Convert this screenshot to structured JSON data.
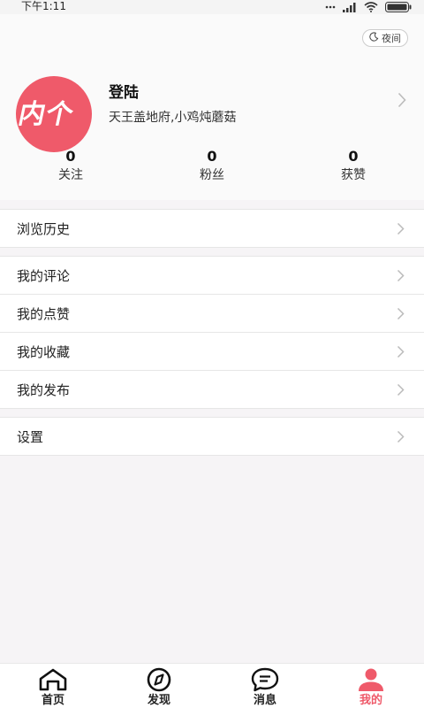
{
  "status_bar": {
    "time": "下午1:11"
  },
  "header": {
    "night_mode_label": "夜间",
    "avatar_text": "内个",
    "username": "登陆",
    "bio": "天王盖地府,小鸡炖蘑菇"
  },
  "stats": [
    {
      "value": "0",
      "label": "关注"
    },
    {
      "value": "0",
      "label": "粉丝"
    },
    {
      "value": "0",
      "label": "获赞"
    }
  ],
  "menu": {
    "history": "浏览历史",
    "comments": "我的评论",
    "likes": "我的点赞",
    "favorites": "我的收藏",
    "posts": "我的发布",
    "settings": "设置"
  },
  "tabs": [
    {
      "label": "首页",
      "icon": "home-icon"
    },
    {
      "label": "发现",
      "icon": "compass-icon"
    },
    {
      "label": "消息",
      "icon": "message-icon"
    },
    {
      "label": "我的",
      "icon": "user-icon"
    }
  ],
  "colors": {
    "accent": "#ef5a6a",
    "background": "#f6f4f6"
  }
}
